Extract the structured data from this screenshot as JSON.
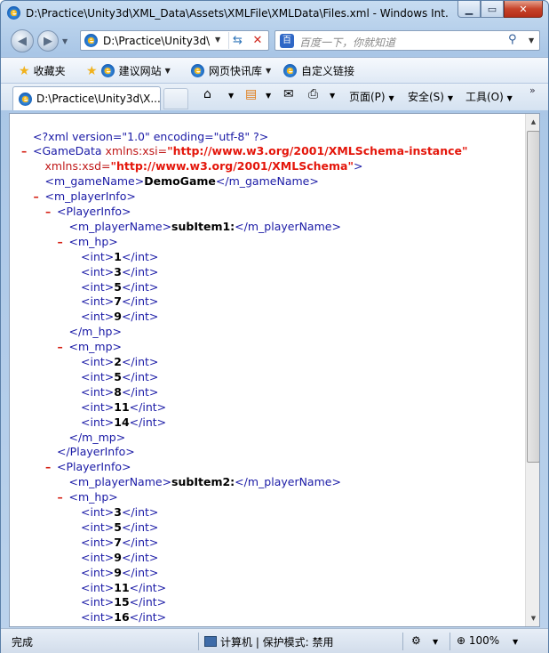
{
  "window": {
    "title": "D:\\Practice\\Unity3d\\XML_Data\\Assets\\XMLFile\\XMLData\\Files.xml - Windows Int...",
    "minimize": "▁",
    "maximize": "▭",
    "close": "✕"
  },
  "nav": {
    "back_icon": "back-arrow-icon",
    "forward_icon": "forward-arrow-icon",
    "address": "D:\\Practice\\Unity3d\\",
    "search_placeholder": "百度一下，你就知道"
  },
  "favorites": {
    "label": "收藏夹",
    "items": [
      "建议网站",
      "网页快讯库",
      "自定义链接"
    ]
  },
  "tab": {
    "label": "D:\\Practice\\Unity3d\\X..."
  },
  "commands": {
    "page": "页面(P)",
    "safety": "安全(S)",
    "tools": "工具(O)"
  },
  "xml": {
    "declaration": "<?xml version=\"1.0\" encoding=\"utf-8\" ?>",
    "gamedata_open": "<GameData",
    "xsi_attr": " xmlns:xsi=",
    "xsi_value": "\"http://www.w3.org/2001/XMLSchema-instance\"",
    "xsd_attr": "xmlns:xsd=",
    "xsd_value": "\"http://www.w3.org/2001/XMLSchema\"",
    "close_bracket": ">",
    "game_name": "DemoGame",
    "players": [
      {
        "name": "subItem1:",
        "hp": [
          "1",
          "3",
          "5",
          "7",
          "9"
        ],
        "mp": [
          "2",
          "5",
          "8",
          "11",
          "14"
        ]
      },
      {
        "name": "subItem2:",
        "hp": [
          "3",
          "5",
          "7",
          "9",
          "9",
          "11",
          "15",
          "16"
        ]
      }
    ]
  },
  "status": {
    "text": "完成",
    "zone": "计算机 | 保护模式: 禁用",
    "zoom": "100%"
  }
}
